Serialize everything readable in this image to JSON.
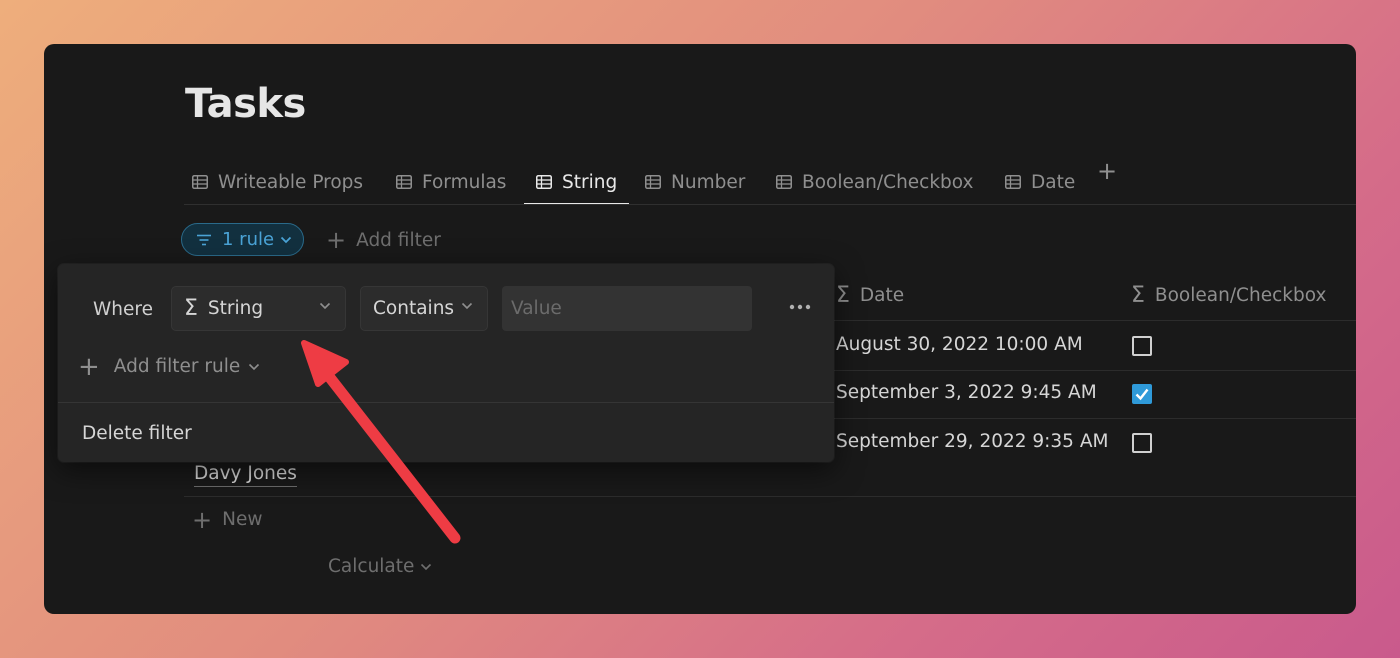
{
  "page": {
    "title": "Tasks"
  },
  "tabs": [
    {
      "label": "Writeable Props",
      "active": false
    },
    {
      "label": "Formulas",
      "active": false
    },
    {
      "label": "String",
      "active": true
    },
    {
      "label": "Number",
      "active": false
    },
    {
      "label": "Boolean/Checkbox",
      "active": false
    },
    {
      "label": "Date",
      "active": false
    }
  ],
  "add_view_label": "+",
  "filter_bar": {
    "rule_chip_label": "1 rule",
    "add_filter_label": "Add filter"
  },
  "filter_popover": {
    "where_label": "Where",
    "property_select": {
      "icon": "sigma-icon",
      "value": "String"
    },
    "operator_select": {
      "value": "Contains"
    },
    "value_input": {
      "value": "",
      "placeholder": "Value"
    },
    "add_rule_label": "Add filter rule",
    "delete_label": "Delete filter"
  },
  "table": {
    "columns": [
      {
        "label": "Date",
        "icon": "sigma-icon"
      },
      {
        "label": "Boolean/Checkbox",
        "icon": "sigma-icon"
      }
    ],
    "rows": [
      {
        "date": "August 30, 2022 10:00 AM",
        "checked": false
      },
      {
        "date": "September 3, 2022 9:45 AM",
        "checked": true
      },
      {
        "date": "September 29, 2022 9:35 AM",
        "checked": false
      }
    ],
    "visible_name": "Davy Jones",
    "new_label": "New",
    "calculate_label": "Calculate"
  },
  "colors": {
    "accent": "#2f9ad9",
    "chip_text": "#4aa3d6",
    "annotation_arrow": "#ee3c44"
  }
}
